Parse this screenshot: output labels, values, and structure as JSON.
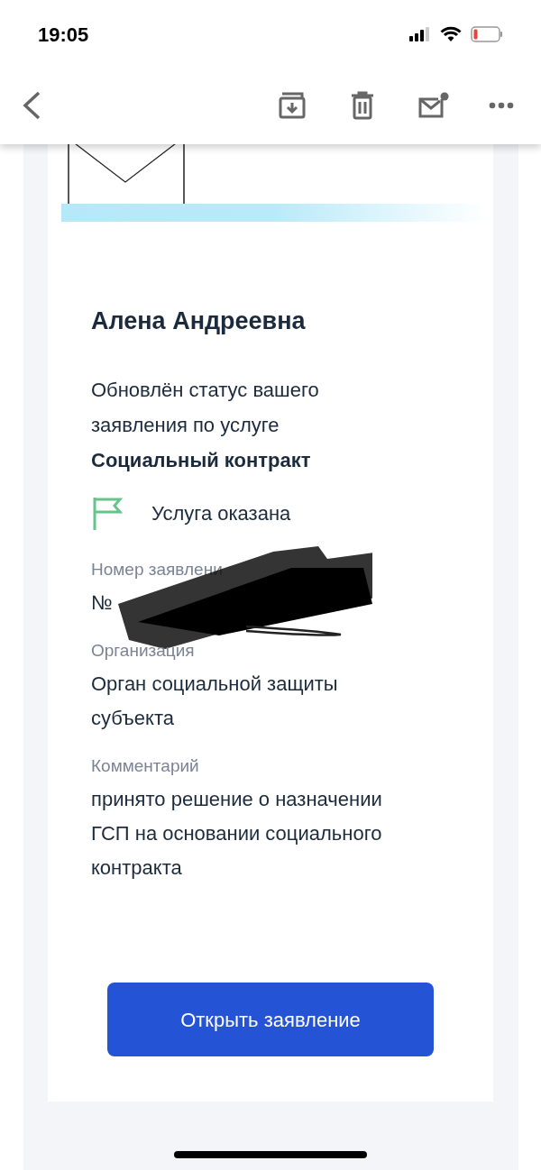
{
  "status_bar": {
    "time": "19:05"
  },
  "letter": {
    "recipient_name": "Алена Андреевна",
    "message": "Обновлён статус вашего заявления по услуге **Социальный контракт**",
    "status": "Услуга оказана",
    "fields": [
      {
        "label": "Номер заявлени",
        "value": "№",
        "redacted": true
      },
      {
        "label": "Организация",
        "value": "Орган социальной защиты субъекта",
        "redacted": false
      },
      {
        "label": "Комментарий",
        "value": "принято решение о назначении ГСП на основании социального контракта",
        "redacted": false
      }
    ],
    "button": "Открыть заявление"
  }
}
